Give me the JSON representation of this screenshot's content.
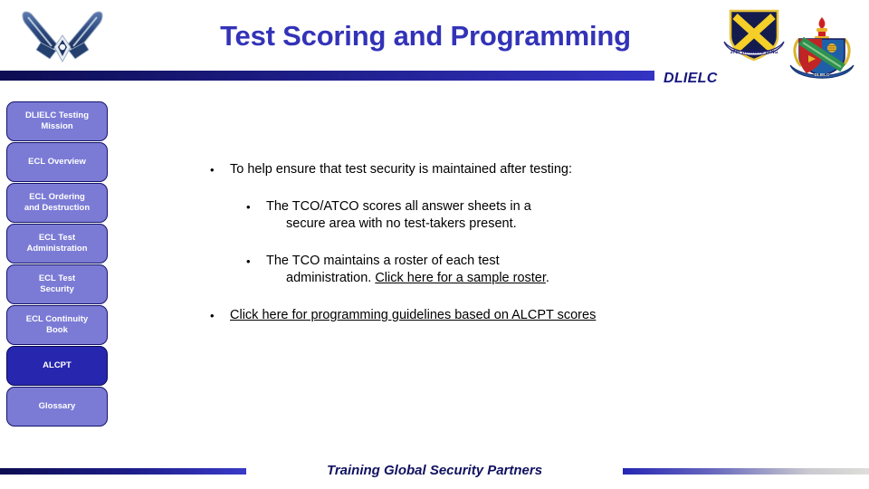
{
  "header": {
    "title": "Test Scoring and Programming",
    "org_label": "DLIELC",
    "af_logo_name": "us-air-force-symbol",
    "wing_crest_name": "37th-training-wing-crest",
    "dlielc_crest_name": "dlielc-crest"
  },
  "sidebar": {
    "items": [
      {
        "label": "DLIELC Testing\nMission",
        "name": "sidebar-item-dlielc-testing-mission",
        "active": false
      },
      {
        "label": "ECL Overview",
        "name": "sidebar-item-ecl-overview",
        "active": false
      },
      {
        "label": "ECL Ordering\nand Destruction",
        "name": "sidebar-item-ecl-ordering-and-destruction",
        "active": false
      },
      {
        "label": "ECL Test\nAdministration",
        "name": "sidebar-item-ecl-test-administration",
        "active": false
      },
      {
        "label": "ECL Test\nSecurity",
        "name": "sidebar-item-ecl-test-security",
        "active": false
      },
      {
        "label": "ECL Continuity\nBook",
        "name": "sidebar-item-ecl-continuity-book",
        "active": false
      },
      {
        "label": "ALCPT",
        "name": "sidebar-item-alcpt",
        "active": true
      },
      {
        "label": "Glossary",
        "name": "sidebar-item-glossary",
        "active": false
      }
    ]
  },
  "content": {
    "bullet1": {
      "marker": "•",
      "text": "To help ensure that test security is maintained after testing:"
    },
    "bullet2": {
      "marker": "•",
      "line1": "The TCO/ATCO scores all answer sheets in a",
      "line2": "secure area with no test-takers present."
    },
    "bullet3": {
      "marker": "•",
      "line1": "The TCO maintains a roster of each test",
      "line2_prefix": "administration. ",
      "line2_link": "Click here for a sample roster",
      "line2_suffix": "."
    },
    "bullet4": {
      "marker": "•",
      "link": "Click here for programming guidelines based on ALCPT scores"
    }
  },
  "footer": {
    "tagline": "Training Global Security Partners"
  },
  "colors": {
    "title_blue": "#3333b8",
    "bar_navy": "#0d0d52",
    "bar_blue": "#3434c4",
    "nav_button": "#7b7bd6",
    "nav_button_active": "#2626ae",
    "footer_navy": "#111160"
  }
}
